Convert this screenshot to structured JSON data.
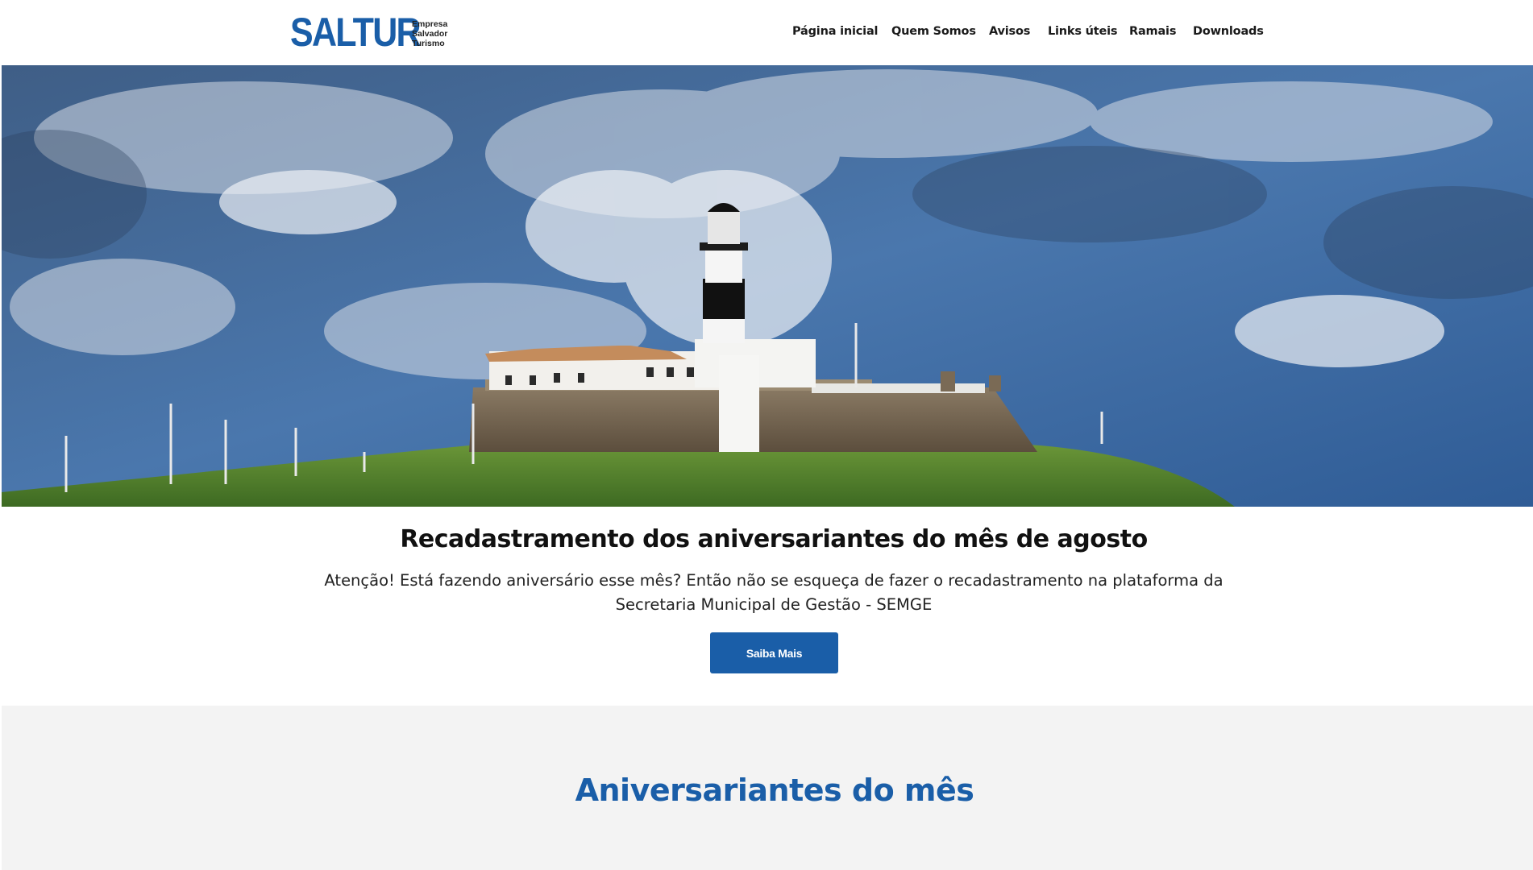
{
  "header": {
    "logo": {
      "word": "SALTUR",
      "sub_line1": "Empresa",
      "sub_line2": "Salvador",
      "sub_line3": "Turismo"
    },
    "nav": [
      "Página inicial",
      "Quem Somos",
      "Avisos",
      "Links úteis",
      "Ramais",
      "Downloads"
    ]
  },
  "hero": {
    "image": "farol-da-barra-lighthouse-photo"
  },
  "announcement": {
    "title": "Recadastramento dos aniversariantes do mês de agosto",
    "text_line1": "Atenção! Está fazendo aniversário esse mês? Então não se esqueça de fazer o recadastramento na plataforma da",
    "text_line2": "Secretaria Municipal de Gestão - SEMGE",
    "button_label": "Saiba Mais"
  },
  "birthdays": {
    "title": "Aniversariantes do mês"
  },
  "colors": {
    "brand": "#1a5ea8",
    "section_bg": "#f3f3f3"
  }
}
